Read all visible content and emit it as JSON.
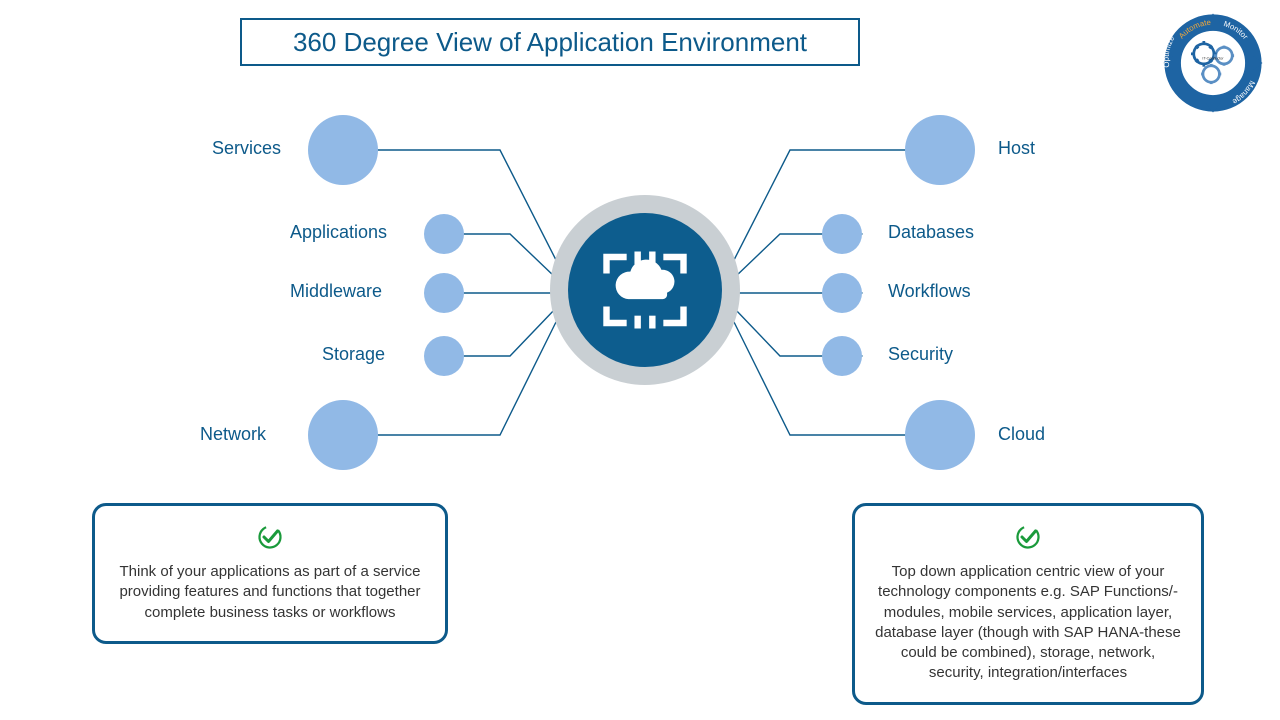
{
  "title": "360 Degree View of Application Environment",
  "branding": {
    "logo_text": "IT-Conductor",
    "arcs": [
      "Automate",
      "Monitor",
      "Manage",
      "Optimize"
    ]
  },
  "hub": {
    "icon": "cloud-infrastructure-icon"
  },
  "nodes": {
    "left": [
      {
        "label": "Services",
        "size": "large"
      },
      {
        "label": "Applications",
        "size": "small"
      },
      {
        "label": "Middleware",
        "size": "small"
      },
      {
        "label": "Storage",
        "size": "small"
      },
      {
        "label": "Network",
        "size": "large"
      }
    ],
    "right": [
      {
        "label": "Host",
        "size": "large"
      },
      {
        "label": "Databases",
        "size": "small"
      },
      {
        "label": "Workflows",
        "size": "small"
      },
      {
        "label": "Security",
        "size": "small"
      },
      {
        "label": "Cloud",
        "size": "large"
      }
    ]
  },
  "callouts": {
    "left": "Think of your applications as part of a service providing features and functions that together complete business tasks or workflows",
    "right": "Top down application centric view of your technology components e.g. SAP Functions/-modules, mobile services, application layer, database layer (though with SAP HANA-these could be combined), storage, network, security, integration/interfaces"
  },
  "colors": {
    "accent": "#0d5a8a",
    "hub": "#0d5d8e",
    "node": "#91b9e6",
    "check": "#1a9a3b"
  }
}
